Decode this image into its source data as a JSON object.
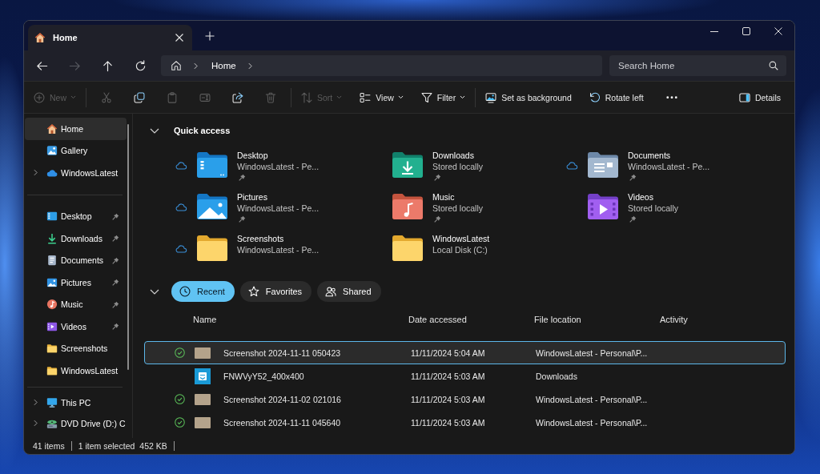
{
  "window": {
    "tab": {
      "label": "Home"
    }
  },
  "navigation": {
    "buttons": [
      {
        "kind": "back",
        "disabled": false
      },
      {
        "kind": "forward",
        "disabled": true
      },
      {
        "kind": "up",
        "disabled": false
      },
      {
        "kind": "refresh",
        "disabled": false
      }
    ],
    "breadcrumbs": [
      "Home"
    ],
    "search": {
      "placeholder": "Search Home"
    }
  },
  "toolbar": {
    "groups": [
      {
        "items": [
          {
            "kind": "new",
            "label": "New",
            "dropdown": true,
            "disabled": true
          }
        ]
      },
      {
        "items": [
          {
            "kind": "cut",
            "dropdown": false,
            "disabled": true
          },
          {
            "kind": "copy",
            "dropdown": false,
            "disabled": false
          },
          {
            "kind": "paste",
            "dropdown": false,
            "disabled": true
          },
          {
            "kind": "rename",
            "dropdown": false,
            "disabled": true
          },
          {
            "kind": "share",
            "dropdown": false,
            "disabled": false
          },
          {
            "kind": "delete",
            "dropdown": false,
            "disabled": true
          }
        ]
      },
      {
        "items": [
          {
            "kind": "sort",
            "label": "Sort",
            "dropdown": true,
            "disabled": true
          },
          {
            "kind": "view",
            "label": "View",
            "dropdown": true,
            "disabled": false
          },
          {
            "kind": "filter",
            "label": "Filter",
            "dropdown": true,
            "disabled": false
          }
        ]
      },
      {
        "items": [
          {
            "kind": "set-background",
            "label": "Set as background",
            "dropdown": false,
            "disabled": false
          },
          {
            "kind": "rotate-left",
            "label": "Rotate left",
            "dropdown": false,
            "disabled": false
          },
          {
            "kind": "more",
            "dropdown": false,
            "disabled": false
          }
        ]
      }
    ],
    "details": {
      "label": "Details"
    }
  },
  "sidebar": {
    "sections": [
      {
        "items": [
          {
            "kind": "home",
            "label": "Home",
            "selected": true,
            "expandable": false,
            "pinned": false
          },
          {
            "kind": "gallery",
            "label": "Gallery",
            "selected": false,
            "expandable": false,
            "pinned": false
          },
          {
            "kind": "cloud",
            "label": "WindowsLatest",
            "selected": false,
            "expandable": true,
            "pinned": false
          }
        ]
      },
      {
        "items": [
          {
            "kind": "desktop",
            "label": "Desktop",
            "selected": false,
            "expandable": false,
            "pinned": true
          },
          {
            "kind": "downloads",
            "label": "Downloads",
            "selected": false,
            "expandable": false,
            "pinned": true
          },
          {
            "kind": "documents",
            "label": "Documents",
            "selected": false,
            "expandable": false,
            "pinned": true
          },
          {
            "kind": "pictures",
            "label": "Pictures",
            "selected": false,
            "expandable": false,
            "pinned": true
          },
          {
            "kind": "music",
            "label": "Music",
            "selected": false,
            "expandable": false,
            "pinned": true
          },
          {
            "kind": "videos",
            "label": "Videos",
            "selected": false,
            "expandable": false,
            "pinned": true
          },
          {
            "kind": "folder",
            "label": "Screenshots",
            "selected": false,
            "expandable": false,
            "pinned": false
          },
          {
            "kind": "folder",
            "label": "WindowsLatest",
            "selected": false,
            "expandable": false,
            "pinned": false
          }
        ]
      },
      {
        "items": [
          {
            "kind": "pc",
            "label": "This PC",
            "selected": false,
            "expandable": true,
            "pinned": false
          },
          {
            "kind": "dvd",
            "label": "DVD Drive (D:) C",
            "selected": false,
            "expandable": true,
            "pinned": false
          }
        ]
      }
    ]
  },
  "quick_access": {
    "title": "Quick access",
    "expanded": true,
    "items": [
      {
        "kind": "desktop",
        "name": "Desktop",
        "detail": "WindowsLatest - Pe...",
        "cloud": true,
        "pinned": true
      },
      {
        "kind": "downloads",
        "name": "Downloads",
        "detail": "Stored locally",
        "cloud": false,
        "pinned": true
      },
      {
        "kind": "documents",
        "name": "Documents",
        "detail": "WindowsLatest - Pe...",
        "cloud": true,
        "pinned": true
      },
      {
        "kind": "pictures",
        "name": "Pictures",
        "detail": "WindowsLatest - Pe...",
        "cloud": true,
        "pinned": true
      },
      {
        "kind": "music",
        "name": "Music",
        "detail": "Stored locally",
        "cloud": false,
        "pinned": true
      },
      {
        "kind": "videos",
        "name": "Videos",
        "detail": "Stored locally",
        "cloud": false,
        "pinned": true
      },
      {
        "kind": "folder",
        "name": "Screenshots",
        "detail": "WindowsLatest - Pe...",
        "cloud": true,
        "pinned": false
      },
      {
        "kind": "folder",
        "name": "WindowsLatest",
        "detail": "Local Disk (C:)",
        "cloud": false,
        "pinned": false
      }
    ]
  },
  "recent": {
    "expanded": true,
    "filters": [
      {
        "kind": "recent",
        "label": "Recent",
        "selected": true
      },
      {
        "kind": "favorites",
        "label": "Favorites",
        "selected": false
      },
      {
        "kind": "shared",
        "label": "Shared",
        "selected": false
      }
    ],
    "columns": [
      "Name",
      "Date accessed",
      "File location",
      "Activity"
    ],
    "rows": [
      {
        "kind": "photo",
        "synced": true,
        "name": "Screenshot 2024-11-11 050423",
        "date": "11/11/2024 5:04 AM",
        "location": "WindowsLatest - Personal\\P...",
        "selected": true
      },
      {
        "kind": "tile",
        "synced": false,
        "name": "FNWVyY52_400x400",
        "date": "11/11/2024 5:03 AM",
        "location": "Downloads",
        "selected": false
      },
      {
        "kind": "photo",
        "synced": true,
        "name": "Screenshot 2024-11-02 021016",
        "date": "11/11/2024 5:03 AM",
        "location": "WindowsLatest - Personal\\P...",
        "selected": false
      },
      {
        "kind": "photo",
        "synced": true,
        "name": "Screenshot 2024-11-11 045640",
        "date": "11/11/2024 5:03 AM",
        "location": "WindowsLatest - Personal\\P...",
        "selected": false
      }
    ]
  },
  "status_bar": {
    "item_count": "41 items",
    "selection": "1 item selected",
    "size": "452 KB"
  }
}
